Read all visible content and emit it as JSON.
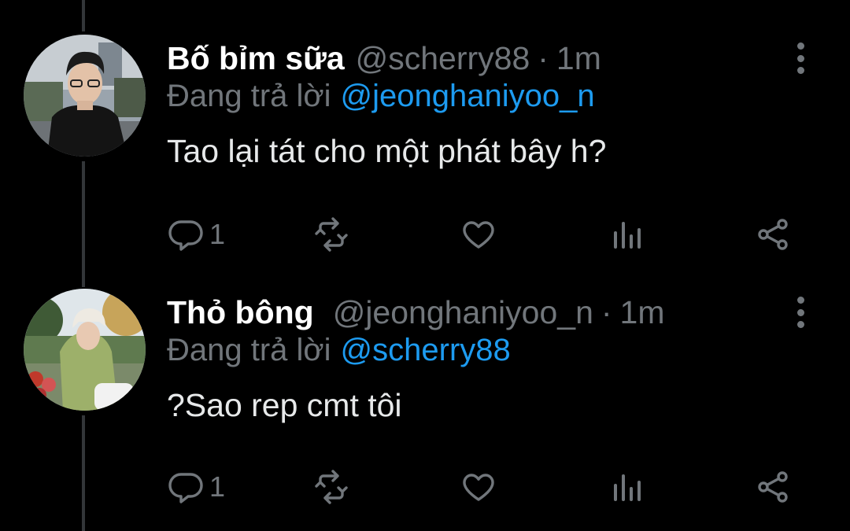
{
  "colors": {
    "background": "#000000",
    "text": "#e7e9ea",
    "muted": "#71767b",
    "link": "#1d9bf0",
    "thread_line": "#333639"
  },
  "tweets": [
    {
      "name": "Bố bỉm sữa",
      "handle": "@scherry88",
      "separator": "·",
      "time": "1m",
      "reply_prefix": "Đang trả lời",
      "reply_to": "@jeonghaniyoo_n",
      "text": "Tao lại tát cho một phát bây h?",
      "reply_count": "1",
      "avatar": "profile-photo-man-black-shirt"
    },
    {
      "name": "Thỏ bông",
      "handle": "@jeonghaniyoo_n",
      "separator": "·",
      "time": "1m",
      "reply_prefix": "Đang trả lời",
      "reply_to": "@scherry88",
      "text": "?Sao rep cmt tôi",
      "reply_count": "1",
      "avatar": "profile-photo-woman-green-hoodie"
    }
  ],
  "icons": {
    "reply": "reply-icon",
    "retweet": "retweet-icon",
    "like": "heart-icon",
    "views": "analytics-icon",
    "share": "share-icon",
    "more": "more-vertical-icon"
  }
}
